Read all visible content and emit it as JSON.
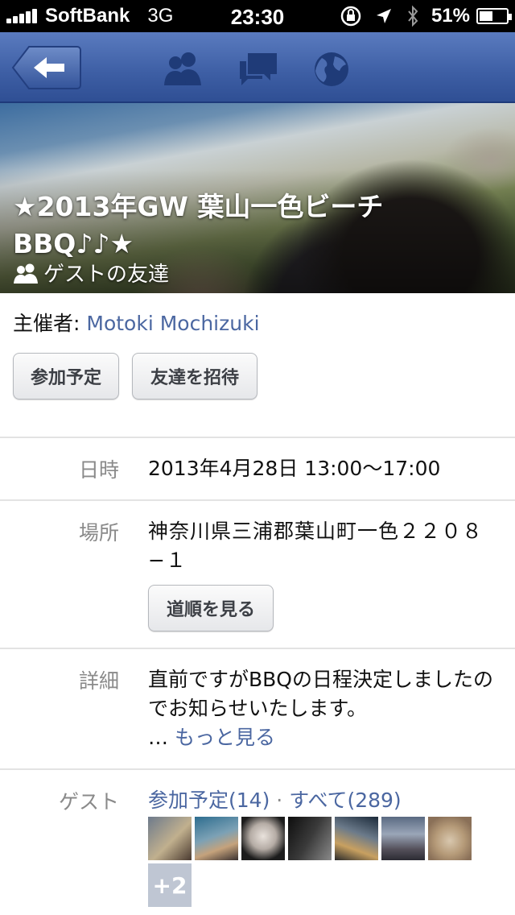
{
  "status_bar": {
    "carrier": "SoftBank",
    "network": "3G",
    "time": "23:30",
    "battery": "51%",
    "battery_level": 0.51,
    "icons": [
      "signal-icon",
      "rotation-lock-icon",
      "location-icon",
      "bluetooth-icon",
      "battery-icon"
    ]
  },
  "nav": {
    "back_icon": "back-arrow-icon",
    "icons": [
      "friends-icon",
      "messages-icon",
      "globe-icon"
    ]
  },
  "event": {
    "title": "★2013年GW 葉山一色ビーチBBQ♪♪★",
    "privacy": "ゲストの友達",
    "host_label": "主催者:",
    "host_name": "Motoki Mochizuki",
    "rsvp_button": "参加予定",
    "invite_button": "友達を招待"
  },
  "details": {
    "date_label": "日時",
    "date_value": "2013年4月28日 13:00〜17:00",
    "place_label": "場所",
    "place_value": "神奈川県三浦郡葉山町一色２２０８−１",
    "directions_button": "道順を見る",
    "detail_label": "詳細",
    "detail_value": "直前ですがBBQの日程決定しましたのでお知らせいたします。",
    "ellipsis": "…",
    "more_link": "もっと見る",
    "guests_label": "ゲスト",
    "guests_going": "参加予定(14)",
    "guests_separator": "·",
    "guests_all": "すべて(289)",
    "guests_more": "+2"
  },
  "colors": {
    "nav_blue": "#3d5ea4",
    "link_blue": "#4b67a1",
    "label_gray": "#8a8a8a"
  }
}
